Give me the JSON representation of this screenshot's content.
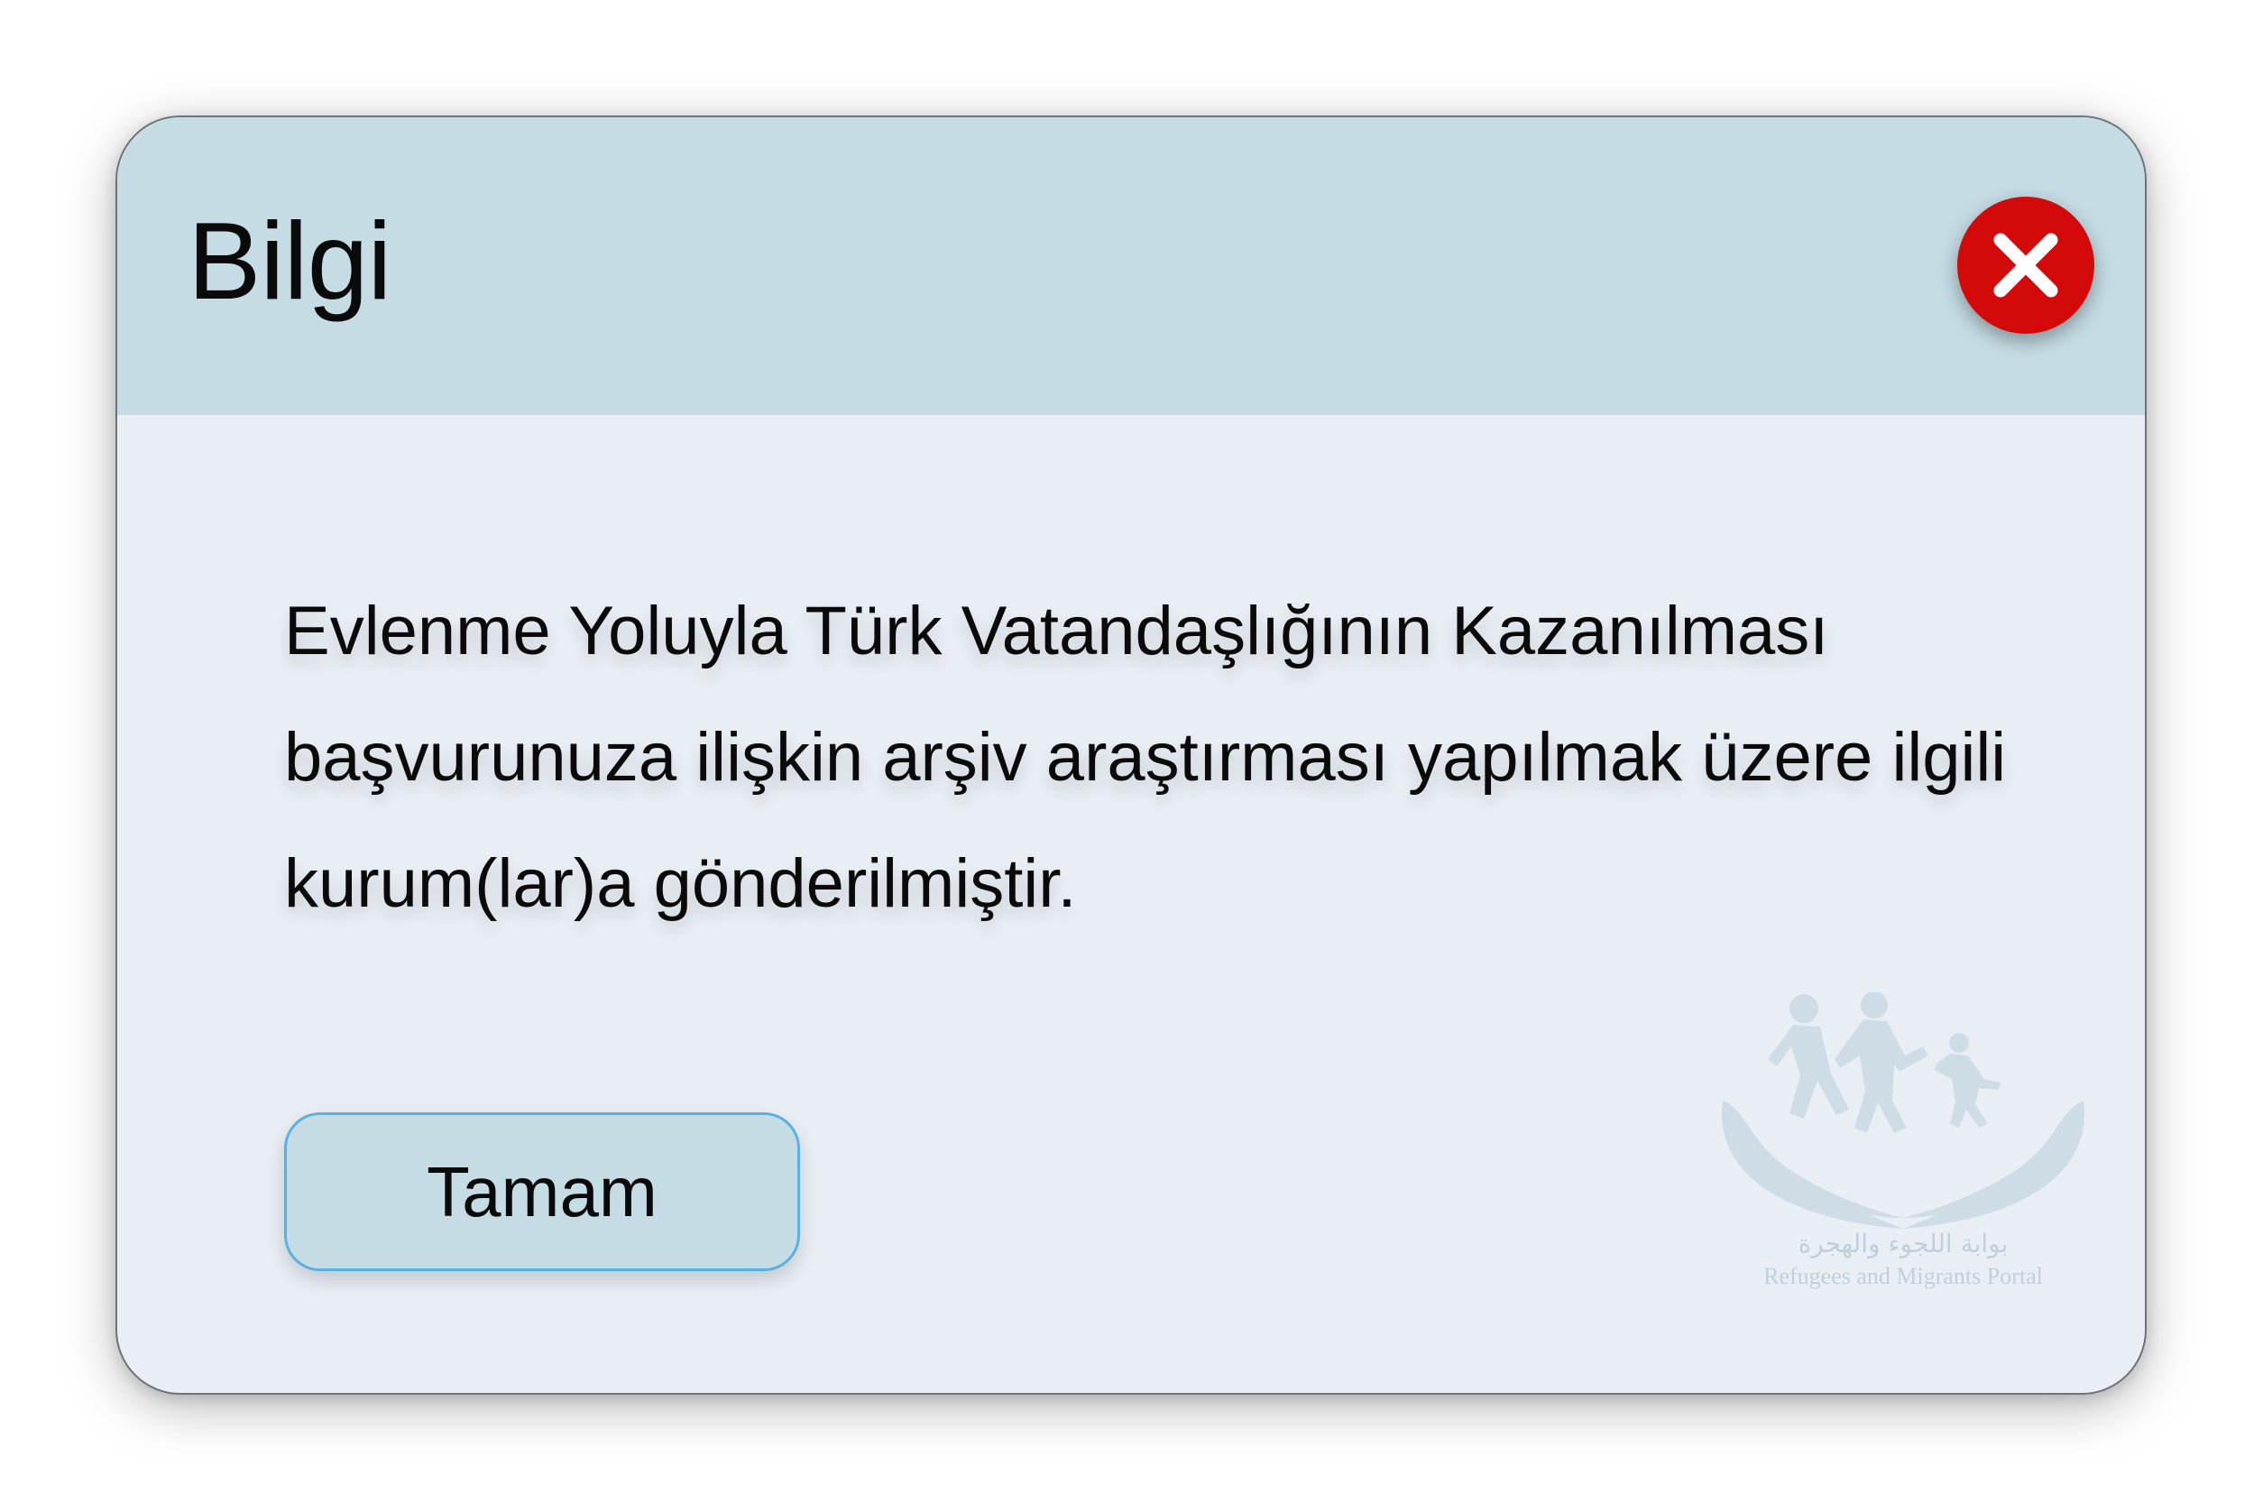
{
  "dialog": {
    "title": "Bilgi",
    "close_icon": "close-x-icon",
    "message": "Evlenme Yoluyla Türk Vatandaşlığının Kazanılması başvurunuza ilişkin arşiv araştırması yapılmak üzere ilgili kurum(lar)a gönderilmiştir.",
    "ok_label": "Tamam",
    "watermark": {
      "icon": "family-hands-logo",
      "arabic": "بوابة اللجوء والهجرة",
      "english": "Refugees and Migrants Portal"
    }
  },
  "colors": {
    "header_bg": "#c5dce5",
    "body_bg": "#e9eef5",
    "close_bg": "#d40a0a",
    "button_border": "#56b2e0"
  }
}
